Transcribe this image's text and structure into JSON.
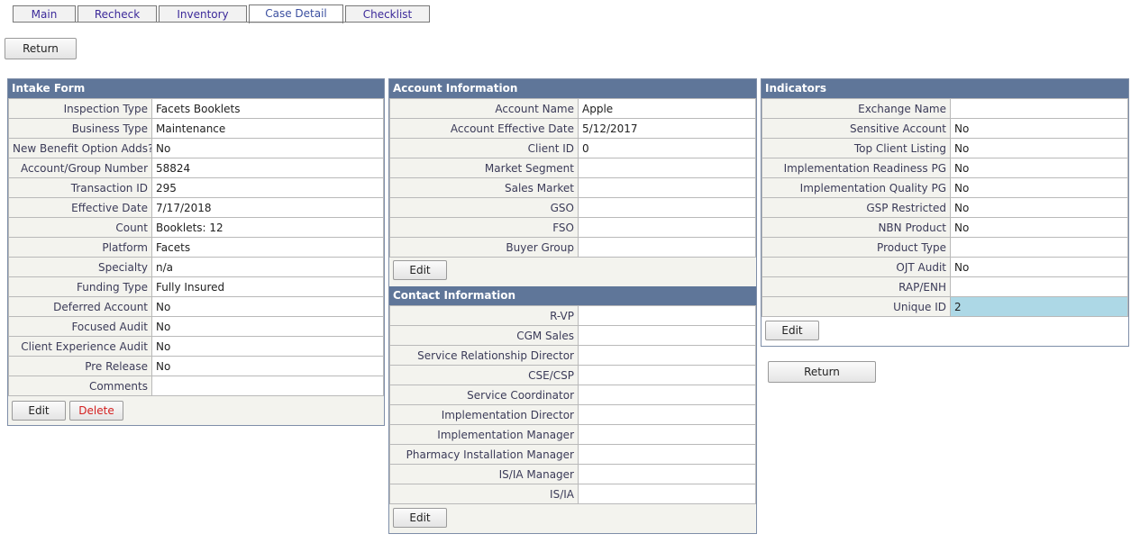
{
  "tabs": [
    {
      "label": "Main"
    },
    {
      "label": "Recheck"
    },
    {
      "label": "Inventory"
    },
    {
      "label": "Case Detail"
    },
    {
      "label": "Checklist"
    }
  ],
  "return_label": "Return",
  "intake": {
    "title": "Intake Form",
    "rows": [
      {
        "label": "Inspection Type",
        "value": "Facets Booklets"
      },
      {
        "label": "Business Type",
        "value": "Maintenance"
      },
      {
        "label": "New Benefit Option Adds?",
        "value": "No"
      },
      {
        "label": "Account/Group Number",
        "value": "58824"
      },
      {
        "label": "Transaction ID",
        "value": "295"
      },
      {
        "label": "Effective Date",
        "value": "7/17/2018"
      },
      {
        "label": "Count",
        "value": "Booklets: 12"
      },
      {
        "label": "Platform",
        "value": "Facets"
      },
      {
        "label": "Specialty",
        "value": "n/a"
      },
      {
        "label": "Funding Type",
        "value": "Fully Insured"
      },
      {
        "label": "Deferred Account",
        "value": "No"
      },
      {
        "label": "Focused Audit",
        "value": "No"
      },
      {
        "label": "Client Experience Audit",
        "value": "No"
      },
      {
        "label": "Pre Release",
        "value": "No"
      },
      {
        "label": "Comments",
        "value": ""
      }
    ],
    "edit_label": "Edit",
    "delete_label": "Delete"
  },
  "account": {
    "title": "Account Information",
    "rows": [
      {
        "label": "Account Name",
        "value": "Apple"
      },
      {
        "label": "Account Effective Date",
        "value": "5/12/2017"
      },
      {
        "label": "Client ID",
        "value": "0"
      },
      {
        "label": "Market Segment",
        "value": ""
      },
      {
        "label": "Sales Market",
        "value": ""
      },
      {
        "label": "GSO",
        "value": ""
      },
      {
        "label": "FSO",
        "value": ""
      },
      {
        "label": "Buyer Group",
        "value": ""
      }
    ],
    "edit_label": "Edit"
  },
  "contact": {
    "title": "Contact Information",
    "rows": [
      {
        "label": "R-VP",
        "value": ""
      },
      {
        "label": "CGM Sales",
        "value": ""
      },
      {
        "label": "Service Relationship Director",
        "value": ""
      },
      {
        "label": "CSE/CSP",
        "value": ""
      },
      {
        "label": "Service Coordinator",
        "value": ""
      },
      {
        "label": "Implementation Director",
        "value": ""
      },
      {
        "label": "Implementation Manager",
        "value": ""
      },
      {
        "label": "Pharmacy Installation Manager",
        "value": ""
      },
      {
        "label": "IS/IA Manager",
        "value": ""
      },
      {
        "label": "IS/IA",
        "value": ""
      }
    ],
    "edit_label": "Edit"
  },
  "indicators": {
    "title": "Indicators",
    "rows": [
      {
        "label": "Exchange Name",
        "value": ""
      },
      {
        "label": "Sensitive Account",
        "value": "No"
      },
      {
        "label": "Top Client Listing",
        "value": "No"
      },
      {
        "label": "Implementation Readiness PG",
        "value": "No"
      },
      {
        "label": "Implementation Quality PG",
        "value": "No"
      },
      {
        "label": "GSP Restricted",
        "value": "No"
      },
      {
        "label": "NBN Product",
        "value": "No"
      },
      {
        "label": "Product Type",
        "value": ""
      },
      {
        "label": "OJT Audit",
        "value": "No"
      },
      {
        "label": "RAP/ENH",
        "value": ""
      },
      {
        "label": "Unique ID",
        "value": "2"
      }
    ],
    "edit_label": "Edit"
  }
}
